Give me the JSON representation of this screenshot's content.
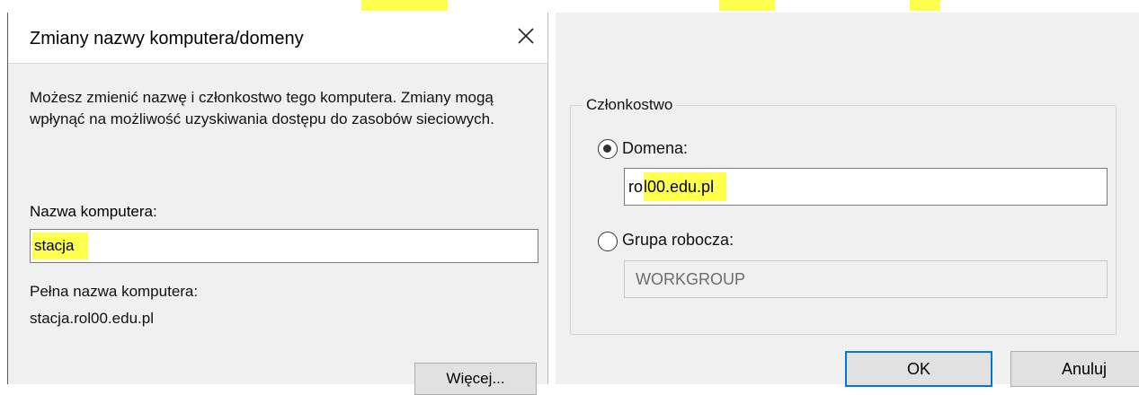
{
  "left_dialog": {
    "title": "Zmiany nazwy komputera/domeny",
    "description": "Możesz zmienić nazwę i członkostwo tego komputera. Zmiany mogą wpłynąć na możliwość uzyskiwania dostępu do zasobów sieciowych.",
    "computer_name_label": "Nazwa komputera:",
    "computer_name_value": "stacja",
    "full_name_label": "Pełna nazwa komputera:",
    "full_name_value": "stacja.rol00.edu.pl",
    "more_button": "Więcej..."
  },
  "right_panel": {
    "group_label": "Członkostwo",
    "domain_radio_label": "Domena:",
    "domain_value_prefix": "ro",
    "domain_value_highlighted": "l00.edu.pl",
    "workgroup_radio_label": "Grupa robocza:",
    "workgroup_value": "WORKGROUP",
    "selected": "domain",
    "ok_button": "OK",
    "cancel_button": "Anuluj"
  },
  "colors": {
    "highlight": "#ffff4d",
    "focus": "#0078d7",
    "dialog_bg": "#f0f0f0"
  }
}
